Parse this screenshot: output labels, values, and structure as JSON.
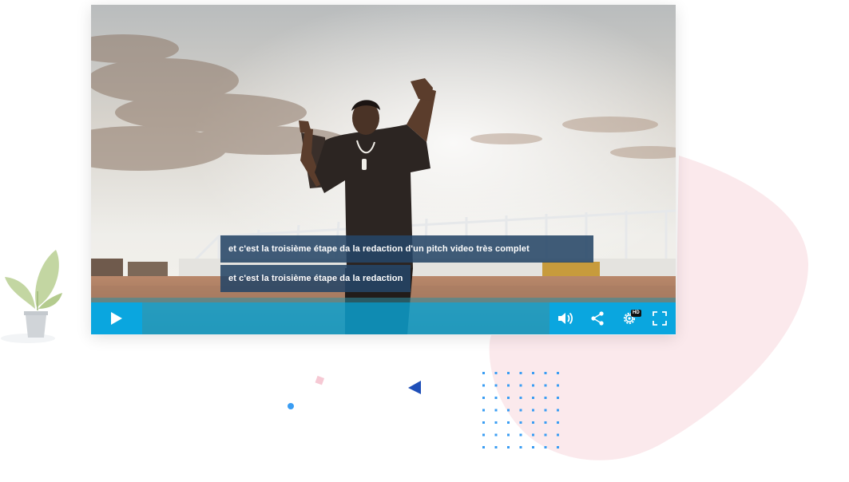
{
  "player": {
    "subtitles": [
      "et c'est la troisième étape da la redaction d'un pitch video très complet",
      "et c'est la troisième étape da la redaction"
    ],
    "hd_badge": "HD",
    "icons": [
      "play-icon",
      "volume-icon",
      "share-icon",
      "settings-icon",
      "fullscreen-icon"
    ]
  },
  "colors": {
    "accent": "#0aa6df",
    "subtitle_bg": "#264666",
    "blob": "#fbe9ec",
    "dots": "#3a9df3",
    "triangle": "#1f4fb8",
    "square": "#f6c9d4",
    "plant_leaf": "#c3d6a2",
    "pot": "#d0d4d8"
  }
}
